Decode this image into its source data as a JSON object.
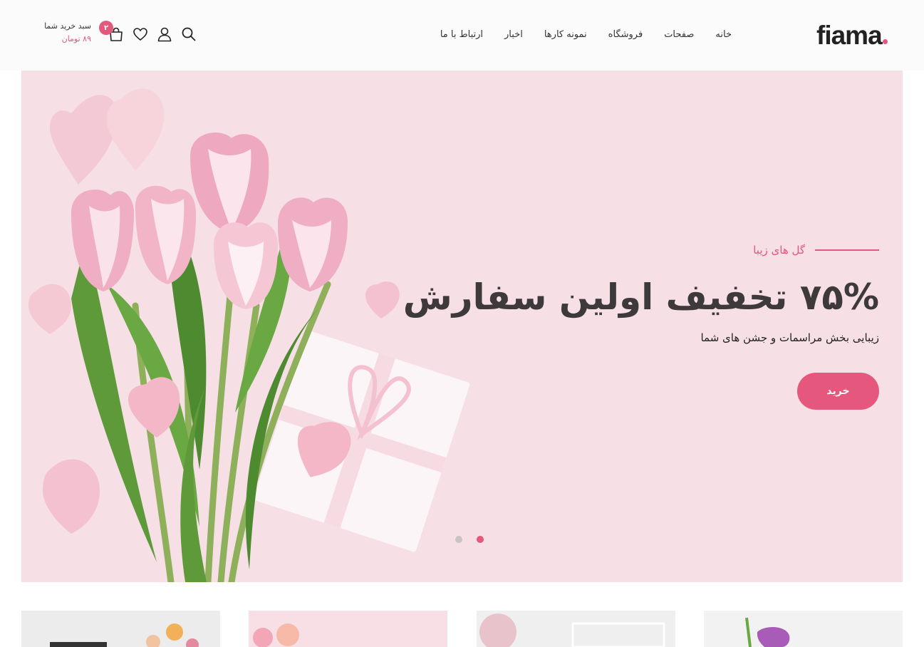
{
  "brand": {
    "name": "fiama",
    "accent": "#e5577c"
  },
  "nav": {
    "items": [
      {
        "label": "خانه"
      },
      {
        "label": "صفحات"
      },
      {
        "label": "فروشگاه"
      },
      {
        "label": "نمونه کارها"
      },
      {
        "label": "اخبار"
      },
      {
        "label": "ارتباط با ما"
      }
    ]
  },
  "header_icons": [
    "search-icon",
    "user-icon",
    "heart-icon",
    "cart-icon"
  ],
  "cart": {
    "label": "سبد خرید شما",
    "amount": "۸۹ تومان",
    "count": "۲"
  },
  "hero": {
    "subtitle": "گل های زیبا",
    "title": "۷۵% تخفیف اولین سفارش",
    "description": "زیبایی بخش مراسمات و جشن های شما",
    "button": "خرید",
    "slides": 2,
    "active_slide": 1
  },
  "cards": 4
}
